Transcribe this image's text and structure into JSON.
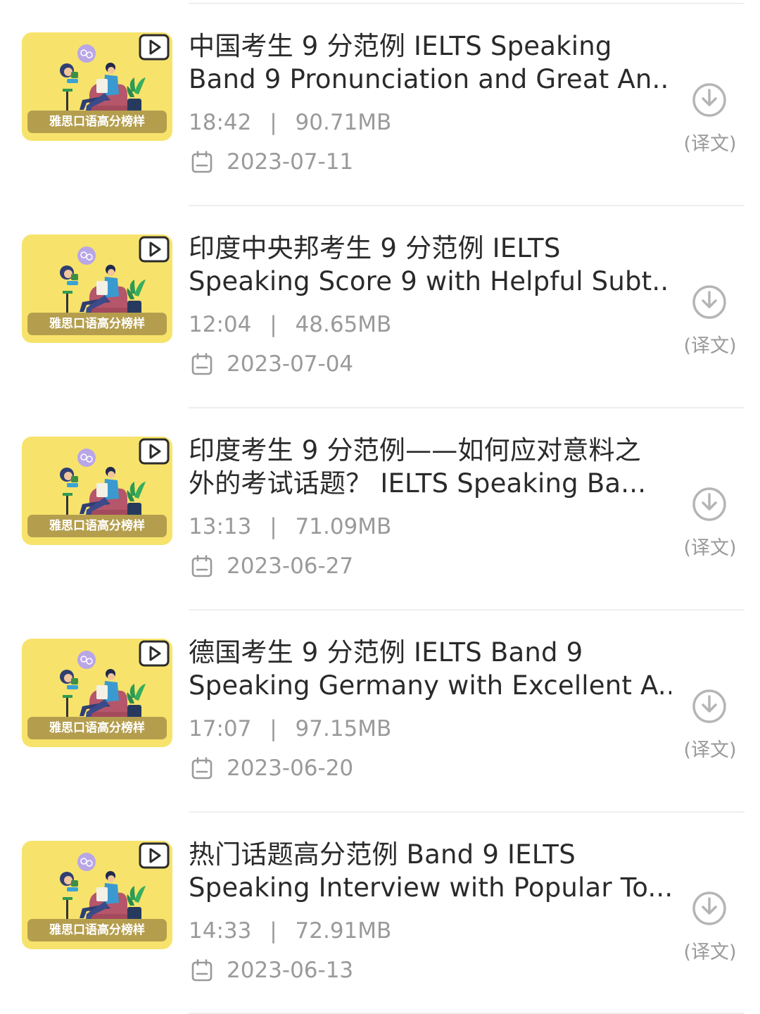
{
  "thumbnail_caption": "雅思口语高分榜样",
  "translate_label": "(译文)",
  "icons": {
    "play": "play-icon",
    "download": "download-icon",
    "calendar": "calendar-icon"
  },
  "colors": {
    "thumbnail_bg": "#f7e36b",
    "caption_bg": "#b49e4e",
    "muted_text": "#9a9a9a",
    "title_text": "#2a2a2a"
  },
  "items": [
    {
      "title_line1": "中国考生 9 分范例 IELTS Speaking",
      "title_line2": "Band 9 Pronunciation and Great An...",
      "duration": "18:42",
      "size": "90.71MB",
      "date": "2023-07-11"
    },
    {
      "title_line1": "印度中央邦考生 9 分范例 IELTS",
      "title_line2": "Speaking Score 9 with Helpful Subt...",
      "duration": "12:04",
      "size": "48.65MB",
      "date": "2023-07-04"
    },
    {
      "title_line1": "印度考生 9 分范例——如何应对意料之",
      "title_line2": "外的考试话题？ IELTS Speaking Ba...",
      "duration": "13:13",
      "size": "71.09MB",
      "date": "2023-06-27"
    },
    {
      "title_line1": "德国考生 9 分范例 IELTS Band 9",
      "title_line2": "Speaking Germany with Excellent A...",
      "duration": "17:07",
      "size": "97.15MB",
      "date": "2023-06-20"
    },
    {
      "title_line1": "热门话题高分范例 Band 9 IELTS",
      "title_line2": "Speaking Interview with Popular To...",
      "duration": "14:33",
      "size": "72.91MB",
      "date": "2023-06-13"
    }
  ],
  "separator": "|"
}
